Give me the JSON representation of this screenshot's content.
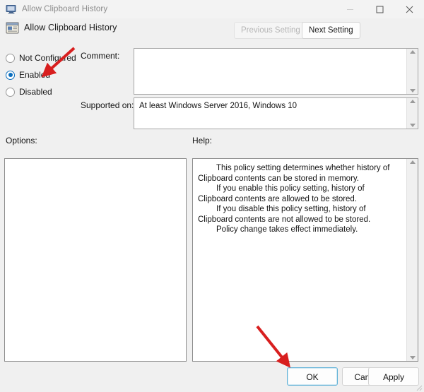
{
  "titlebar": {
    "title": "Allow Clipboard History",
    "icon": "policy-window-icon",
    "minimize_label": "Minimize",
    "maximize_label": "Maximize",
    "close_label": "Close"
  },
  "header": {
    "title": "Allow Clipboard History",
    "icon": "policy-setting-icon",
    "previous_button": "Previous Setting",
    "previous_disabled": true,
    "next_button": "Next Setting",
    "next_disabled": false
  },
  "settings": {
    "options": [
      {
        "label": "Not Configured",
        "selected": false
      },
      {
        "label": "Enabled",
        "selected": true
      },
      {
        "label": "Disabled",
        "selected": false
      }
    ],
    "comment_label": "Comment:",
    "comment_value": "",
    "supported_label": "Supported on:",
    "supported_value": "At least Windows Server 2016, Windows 10"
  },
  "panels": {
    "options_label": "Options:",
    "options_content": "",
    "help_label": "Help:",
    "help_paragraphs": [
      "This policy setting determines whether history of Clipboard contents can be stored in memory.",
      "If you enable this policy setting, history of Clipboard contents are allowed to be stored.",
      "If you disable this policy setting, history of Clipboard contents are not allowed to be stored.",
      "Policy change takes effect immediately."
    ]
  },
  "footer": {
    "ok_label": "OK",
    "cancel_label": "Cancel",
    "apply_label": "Apply"
  },
  "annotations": [
    {
      "name": "arrow-pointing-to-enabled",
      "color": "#d81f1f"
    },
    {
      "name": "arrow-pointing-to-ok",
      "color": "#d81f1f"
    }
  ],
  "colors": {
    "accent": "#0a6ebd",
    "annotation": "#d81f1f",
    "window_bg": "#f0f0f0",
    "focus_border": "#63b3d8"
  }
}
